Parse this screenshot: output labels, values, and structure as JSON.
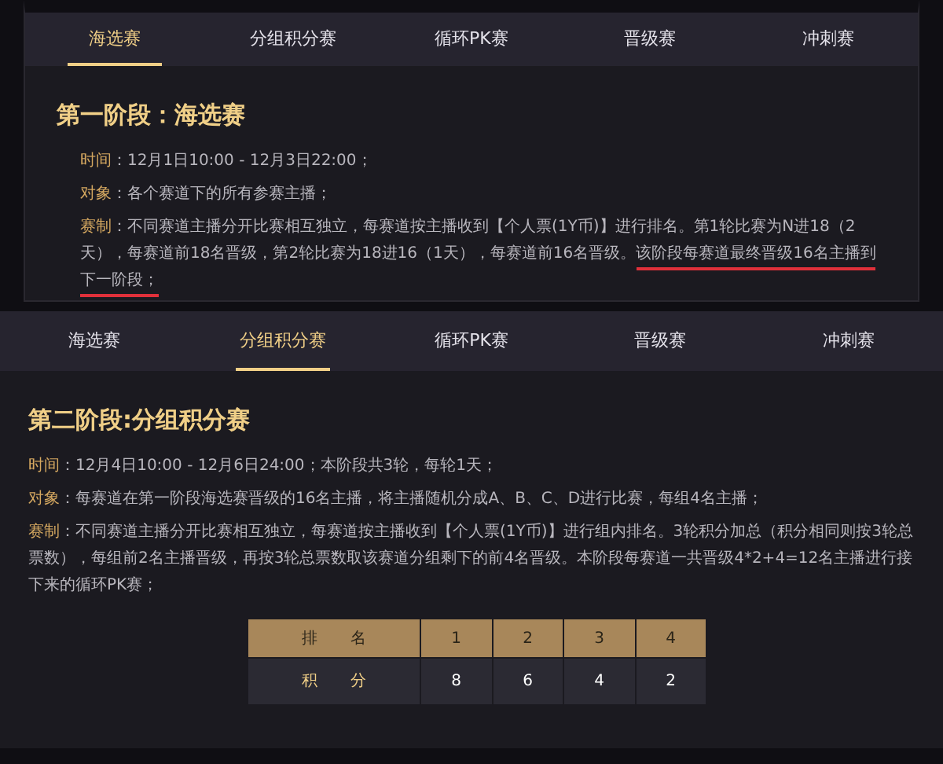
{
  "panels": [
    {
      "tabs": [
        {
          "label": "海选赛",
          "selected": true
        },
        {
          "label": "分组积分赛",
          "selected": false
        },
        {
          "label": "循环PK赛",
          "selected": false
        },
        {
          "label": "晋级赛",
          "selected": false
        },
        {
          "label": "冲刺赛",
          "selected": false
        }
      ],
      "title": "第一阶段：海选赛",
      "fields": [
        {
          "label": "时间",
          "text": "：12月1日10:00 - 12月3日22:00；"
        },
        {
          "label": "对象",
          "text": "：各个赛道下的所有参赛主播；"
        },
        {
          "label": "赛制",
          "text": "：不同赛道主播分开比赛相互独立，每赛道按主播收到【个人票(1Y币)】进行排名。第1轮比赛为N进18（2天），每赛道前18名晋级，第2轮比赛为18进16（1天），每赛道前16名晋级。",
          "underlined": "该阶段每赛道最终晋级16名主播到下一阶段；"
        }
      ]
    },
    {
      "tabs": [
        {
          "label": "海选赛",
          "selected": false
        },
        {
          "label": "分组积分赛",
          "selected": true
        },
        {
          "label": "循环PK赛",
          "selected": false
        },
        {
          "label": "晋级赛",
          "selected": false
        },
        {
          "label": "冲刺赛",
          "selected": false
        }
      ],
      "title": "第二阶段:分组积分赛",
      "fields": [
        {
          "label": "时间",
          "text": "：12月4日10:00 - 12月6日24:00；本阶段共3轮，每轮1天；"
        },
        {
          "label": "对象",
          "text": "：每赛道在第一阶段海选赛晋级的16名主播，将主播随机分成A、B、C、D进行比赛，每组4名主播；"
        },
        {
          "label": "赛制",
          "text": "：不同赛道主播分开比赛相互独立，每赛道按主播收到【个人票(1Y币)】进行组内排名。3轮积分加总（积分相同则按3轮总票数），每组前2名主播晋级，再按3轮总票数取该赛道分组剩下的前4名晋级。本阶段每赛道一共晋级4*2+4=12名主播进行接下来的循环PK赛；"
        }
      ],
      "table": {
        "rows": [
          [
            "排 名",
            "1",
            "2",
            "3",
            "4"
          ],
          [
            "积 分",
            "8",
            "6",
            "4",
            "2"
          ]
        ]
      }
    }
  ]
}
